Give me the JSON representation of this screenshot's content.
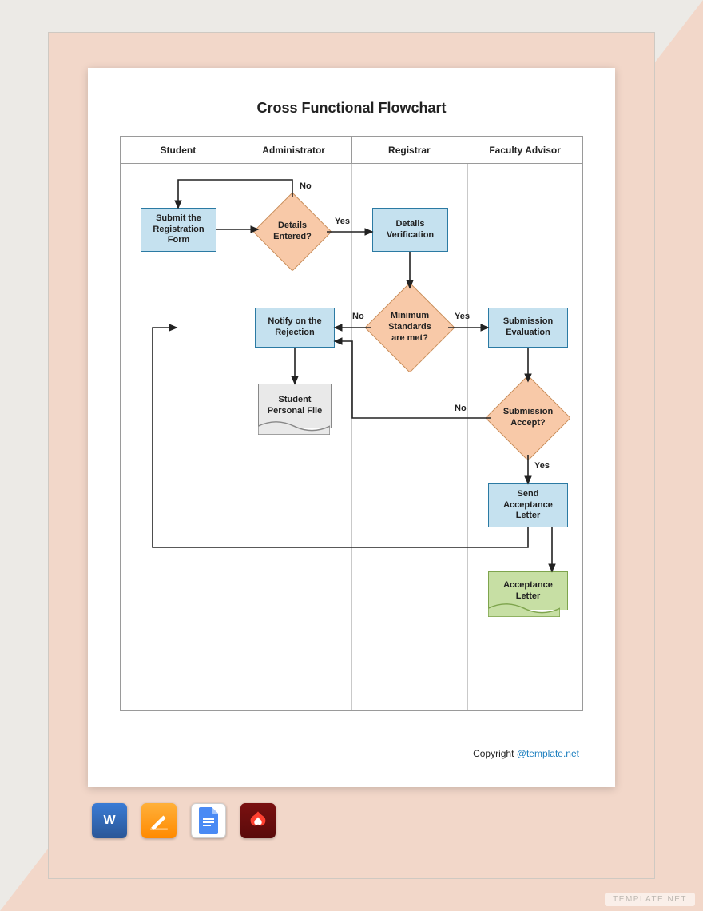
{
  "title": "Cross Functional Flowchart",
  "lanes": [
    "Student",
    "Administrator",
    "Registrar",
    "Faculty Advisor"
  ],
  "nodes": {
    "submit": "Submit the Registration Form",
    "entered": "Details Entered?",
    "verify": "Details Verification",
    "standards": "Minimum Standards are met?",
    "notify": "Notify on the Rejection",
    "eval": "Submission Evaluation",
    "accept": "Submission Accept?",
    "file": "Student Personal File",
    "sendLetter": "Send Acceptance Letter",
    "letter": "Acceptance Letter"
  },
  "edges": {
    "no": "No",
    "yes": "Yes"
  },
  "copyright": {
    "label": "Copyright ",
    "link": "@template.net"
  },
  "icons": {
    "word": "W",
    "pages": "pages-icon",
    "docs": "docs-icon",
    "pdf": "pdf-icon"
  },
  "watermark": "TEMPLATE.NET"
}
